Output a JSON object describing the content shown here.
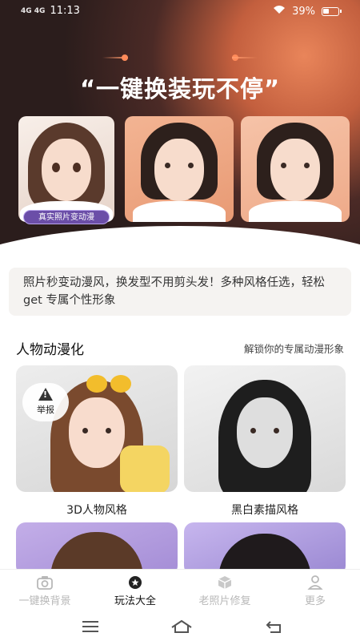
{
  "status_bar": {
    "signal_left": "4G 4G",
    "time": "11:13",
    "battery": "39%"
  },
  "hero": {
    "title": "“一键换装玩不停”",
    "badge": "真实照片变动漫"
  },
  "info": {
    "text": "照片秒变动漫风，换发型不用剪头发！多种风格任选，轻松 get 专属个性形象"
  },
  "section": {
    "title": "人物动漫化",
    "subtitle": "解锁你的专属动漫形象"
  },
  "cards": [
    {
      "label": "3D人物风格"
    },
    {
      "label": "黑白素描风格"
    }
  ],
  "report": {
    "label": "举报"
  },
  "nav": {
    "items": [
      {
        "label": "一键换背景",
        "icon": "camera-icon"
      },
      {
        "label": "玩法大全",
        "icon": "star-icon"
      },
      {
        "label": "老照片修复",
        "icon": "cube-icon"
      },
      {
        "label": "更多",
        "icon": "person-icon"
      }
    ],
    "active_index": 1
  },
  "colors": {
    "hero_dark": "#2b1d1c",
    "hero_accent": "#e9855a",
    "badge_purple": "#6b4ea8",
    "info_bg": "#f5f3f1"
  }
}
